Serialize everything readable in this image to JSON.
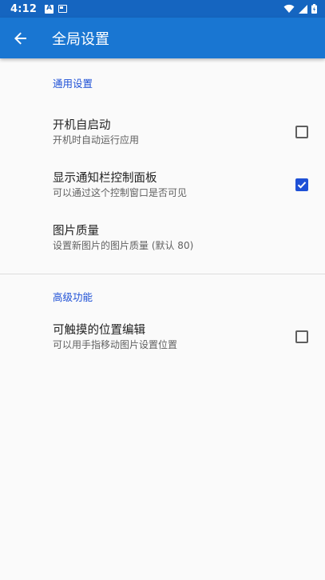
{
  "status_bar": {
    "time": "4:12"
  },
  "app_bar": {
    "title": "全局设置"
  },
  "sections": [
    {
      "header": "通用设置",
      "items": [
        {
          "title": "开机自启动",
          "summary": "开机时自动运行应用",
          "checked": false
        },
        {
          "title": "显示通知栏控制面板",
          "summary": "可以通过这个控制窗口是否可见",
          "checked": true
        },
        {
          "title": "图片质量",
          "summary": "设置新图片的图片质量 (默认 80)"
        }
      ]
    },
    {
      "header": "高级功能",
      "items": [
        {
          "title": "可触摸的位置编辑",
          "summary": "可以用手指移动图片设置位置",
          "checked": false
        }
      ]
    }
  ],
  "colors": {
    "status_bar": "#1565c0",
    "app_bar": "#1976d2",
    "accent": "#1e50d6"
  },
  "icons": [
    "arrow-back-icon",
    "wifi-icon",
    "signal-icon",
    "battery-icon",
    "accessibility-icon",
    "cast-icon"
  ]
}
